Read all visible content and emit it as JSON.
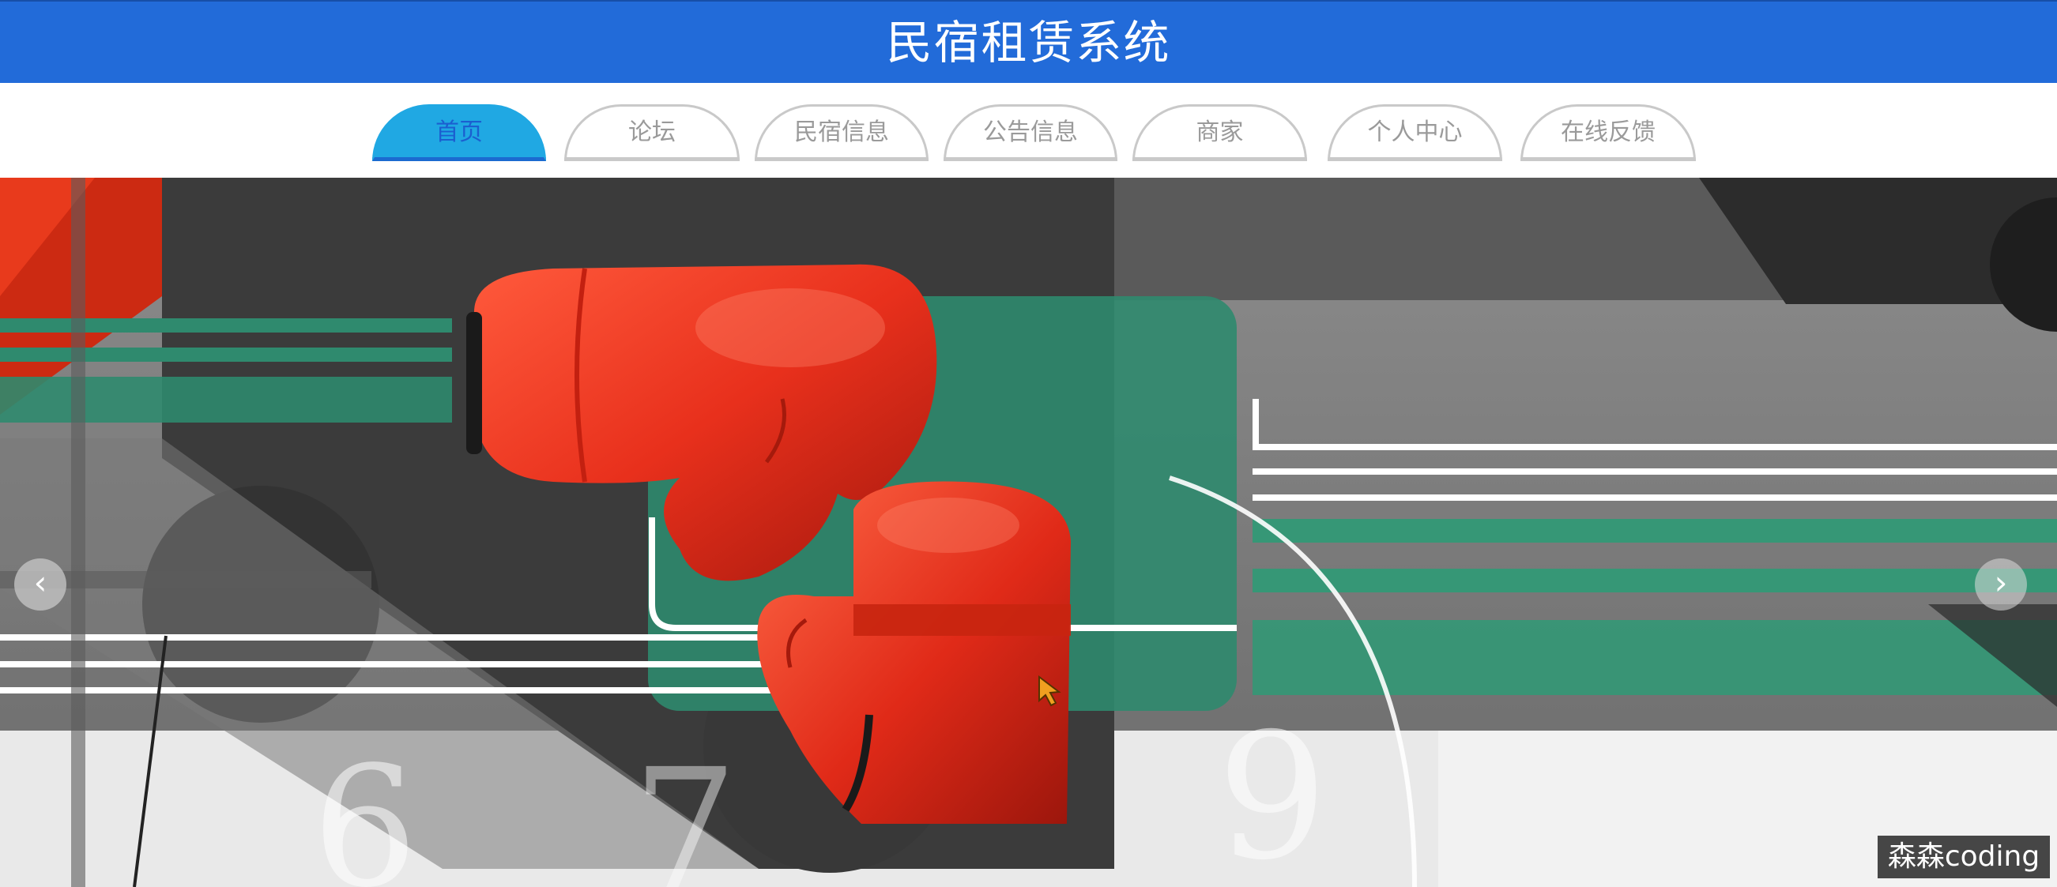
{
  "header": {
    "title": "民宿租赁系统",
    "background_color": "#226bd9"
  },
  "nav": {
    "tabs": [
      {
        "label": "首页",
        "active": true
      },
      {
        "label": "论坛",
        "active": false
      },
      {
        "label": "民宿信息",
        "active": false
      },
      {
        "label": "公告信息",
        "active": false
      },
      {
        "label": "商家",
        "active": false
      },
      {
        "label": "个人中心",
        "active": false
      },
      {
        "label": "在线反馈",
        "active": false
      }
    ],
    "active_color": "#20a8e3"
  },
  "banner": {
    "image": "boxing-gloves-illustration",
    "prev_icon": "chevron-left-icon",
    "next_icon": "chevron-right-icon",
    "colors": {
      "glove": "#e8301c",
      "accent_green": "#2f8a6e",
      "dark": "#3a3a3a"
    }
  },
  "watermark": {
    "text": "森森coding"
  }
}
